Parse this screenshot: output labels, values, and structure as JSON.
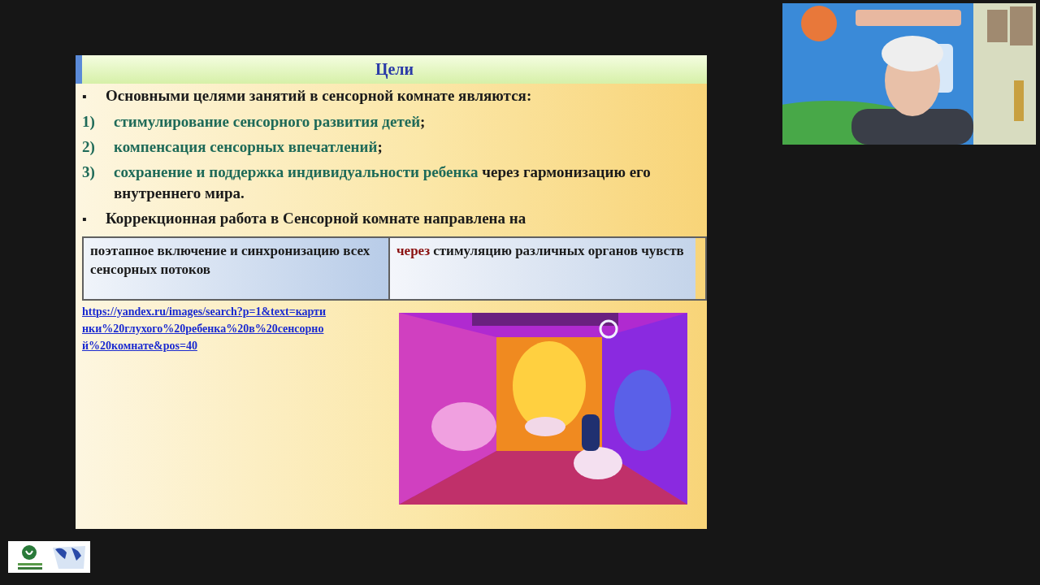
{
  "slide": {
    "title": "Цели",
    "items": [
      {
        "kind": "bullet",
        "marker": "▪",
        "text": "Основными целями занятий в сенсорной комнате являются:"
      },
      {
        "kind": "numbered",
        "marker": "1)",
        "accent": "стимулирование сенсорного развития детей",
        "text": ";"
      },
      {
        "kind": "numbered",
        "marker": "2)",
        "accent": "компенсация сенсорных впечатлений",
        "text": ";"
      },
      {
        "kind": "numbered",
        "marker": "3)",
        "accent": "сохранение и поддержка индивидуальности ребенка",
        "text": " через гармонизацию его внутреннего мира."
      },
      {
        "kind": "bullet",
        "marker": "▪",
        "text": "Коррекционная работа в Сенсорной комнате направлена на"
      }
    ],
    "table": [
      {
        "text": "поэтапное включение и синхронизацию всех сенсорных потоков"
      },
      {
        "accent": "через",
        "text": " стимуляцию различных органов чувств"
      }
    ],
    "link": "https://yandex.ru/images/search?p=1&text=картинки%20глухого%20ребенка%20в%20сенсорной%20комнате&pos=40"
  }
}
